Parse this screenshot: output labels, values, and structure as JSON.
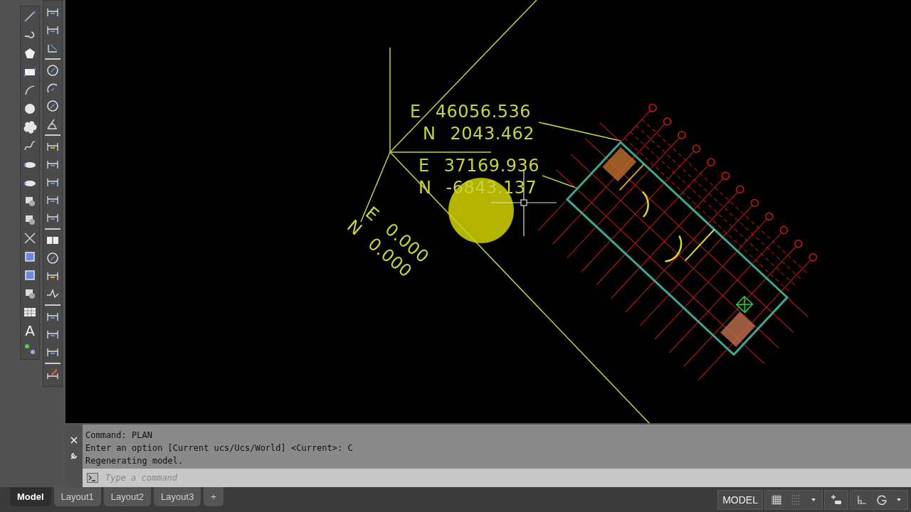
{
  "drawing": {
    "coordinate_labels": [
      {
        "kind": "upright",
        "easting": "E 46056.536",
        "northing": "N 2043.462"
      },
      {
        "kind": "upright",
        "easting": "E 37169.936",
        "northing": "N -6843.137"
      },
      {
        "kind": "rotated",
        "easting": "E 0.000",
        "northing": "N 0.000"
      }
    ]
  },
  "draw_toolbar": {
    "text_tool": "A"
  },
  "command_window": {
    "history": [
      "Command: PLAN",
      "Enter an option [Current ucs/Ucs/World] <Current>: C",
      "Regenerating model."
    ],
    "placeholder": "Type a command"
  },
  "tabs": [
    {
      "label": "Model",
      "selected": true
    },
    {
      "label": "Layout1",
      "selected": false
    },
    {
      "label": "Layout2",
      "selected": false
    },
    {
      "label": "Layout3",
      "selected": false
    },
    {
      "label": "+",
      "selected": false
    }
  ],
  "status_bar": {
    "space": "MODEL"
  }
}
